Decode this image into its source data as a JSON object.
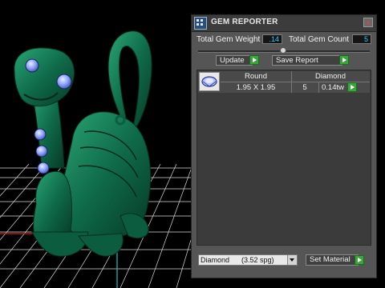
{
  "panel": {
    "title": "GEM REPORTER",
    "close_glyph": "x",
    "total_weight_label": "Total Gem Weight",
    "total_weight_value": ".14",
    "total_count_label": "Total Gem Count",
    "total_count_value": "5",
    "update_label": "Update",
    "save_report_label": "Save Report",
    "set_material_label": "Set Material",
    "material_selected": "Diamond      (3.52 spg)"
  },
  "gem_table": {
    "rows": [
      {
        "shape": "Round",
        "size": "1.95 X 1.95",
        "material": "Diamond",
        "count": "5",
        "weight": "0.14tw",
        "thumbnail_icon": "round-gem-icon"
      }
    ]
  },
  "icons": {
    "app": "gem-reporter-app-icon",
    "close": "close-icon",
    "go": "green-arrow-icon",
    "dropdown": "chevron-down-icon"
  },
  "colors": {
    "panel_bg": "#555555",
    "value_text": "#35c8ff",
    "go_button": "#3aa53a",
    "model": "#0f6b4a",
    "gems": "#8fa6ff"
  }
}
